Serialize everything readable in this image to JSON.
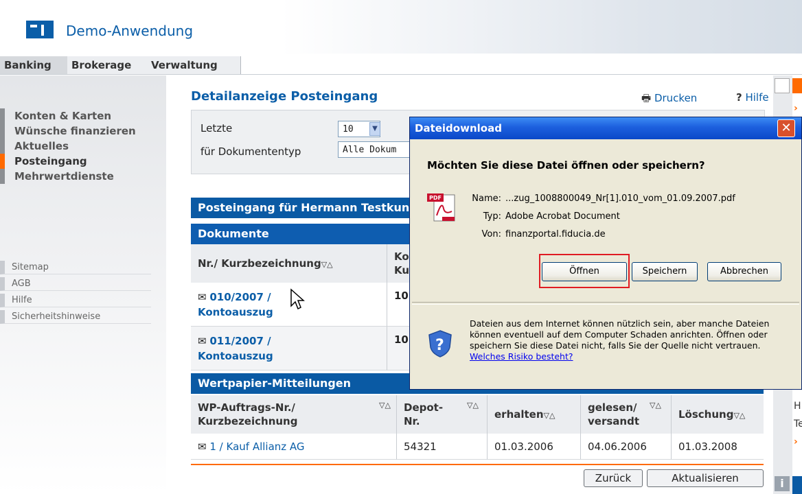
{
  "header": {
    "app_title": "Demo-Anwendung"
  },
  "tabs": [
    {
      "label": "Banking"
    },
    {
      "label": "Brokerage"
    },
    {
      "label": "Verwaltung"
    }
  ],
  "sidebar": {
    "items": [
      {
        "label": "Konten & Karten"
      },
      {
        "label": "Wünsche finanzieren"
      },
      {
        "label": "Aktuelles"
      },
      {
        "label": "Posteingang"
      },
      {
        "label": "Mehrwertdienste"
      }
    ],
    "links": [
      {
        "label": "Sitemap"
      },
      {
        "label": "AGB"
      },
      {
        "label": "Hilfe"
      },
      {
        "label": "Sicherheitshinweise"
      }
    ]
  },
  "main": {
    "title": "Detailanzeige Posteingang",
    "print_label": "Drucken",
    "help_label": "Hilfe",
    "filter": {
      "last_label": "Letzte",
      "last_value": "10",
      "doctype_label": "für Dokumententyp",
      "doctype_value": "Alle Dokum"
    },
    "inbox_band": "Posteingang für Hermann Testkun",
    "documents": {
      "band": "Dokumente",
      "col_nr": "Nr./ Kurzbezeichnung",
      "col_k": "Ko\nKu",
      "sort_glyph": "▽△",
      "rows": [
        {
          "nr": "010/2007 /",
          "desc": "Kontoauszug",
          "k": "10"
        },
        {
          "nr": "011/2007 /",
          "desc": "Kontoauszug",
          "k": "10"
        }
      ]
    },
    "securities": {
      "band": "Wertpapier-Mitteilungen",
      "col_order": "WP-Auftrags-Nr./\nKurzbezeichnung",
      "col_depot": "Depot-\nNr.",
      "col_received": "erhalten",
      "col_read": "gelesen/\nversandt",
      "col_delete": "Löschung",
      "sort_glyph": "▽△",
      "rows": [
        {
          "order": "1 / Kauf Allianz AG",
          "depot": "54321",
          "received": "01.03.2006",
          "read": "04.06.2006",
          "delete": "01.03.2008"
        }
      ]
    },
    "back_button": "Zurück",
    "refresh_button": "Aktualisieren"
  },
  "dialog": {
    "title": "Dateidownload",
    "question": "Möchten Sie diese Datei öffnen oder speichern?",
    "name_label": "Name:",
    "name_value": "...zug_1008800049_Nr[1].010_vom_01.09.2007.pdf",
    "type_label": "Typ:",
    "type_value": "Adobe Acrobat Document",
    "from_label": "Von:",
    "from_value": "finanzportal.fiducia.de",
    "open_button": "Öffnen",
    "save_button": "Speichern",
    "cancel_button": "Abbrechen",
    "warning_text": "Dateien aus dem Internet können nützlich sein, aber manche Dateien können eventuell auf dem Computer Schaden anrichten. Öffnen oder speichern Sie diese Datei nicht, falls Sie der Quelle nicht vertrauen.",
    "risk_link": "Welches Risiko besteht?"
  },
  "right_column": {
    "text_h": "H",
    "text_te": "Te"
  },
  "colors": {
    "brand_blue": "#0a5aa4",
    "accent_orange": "#ff6a00",
    "dialog_title": "#1c5fde",
    "highlight_red": "#e01b22"
  }
}
